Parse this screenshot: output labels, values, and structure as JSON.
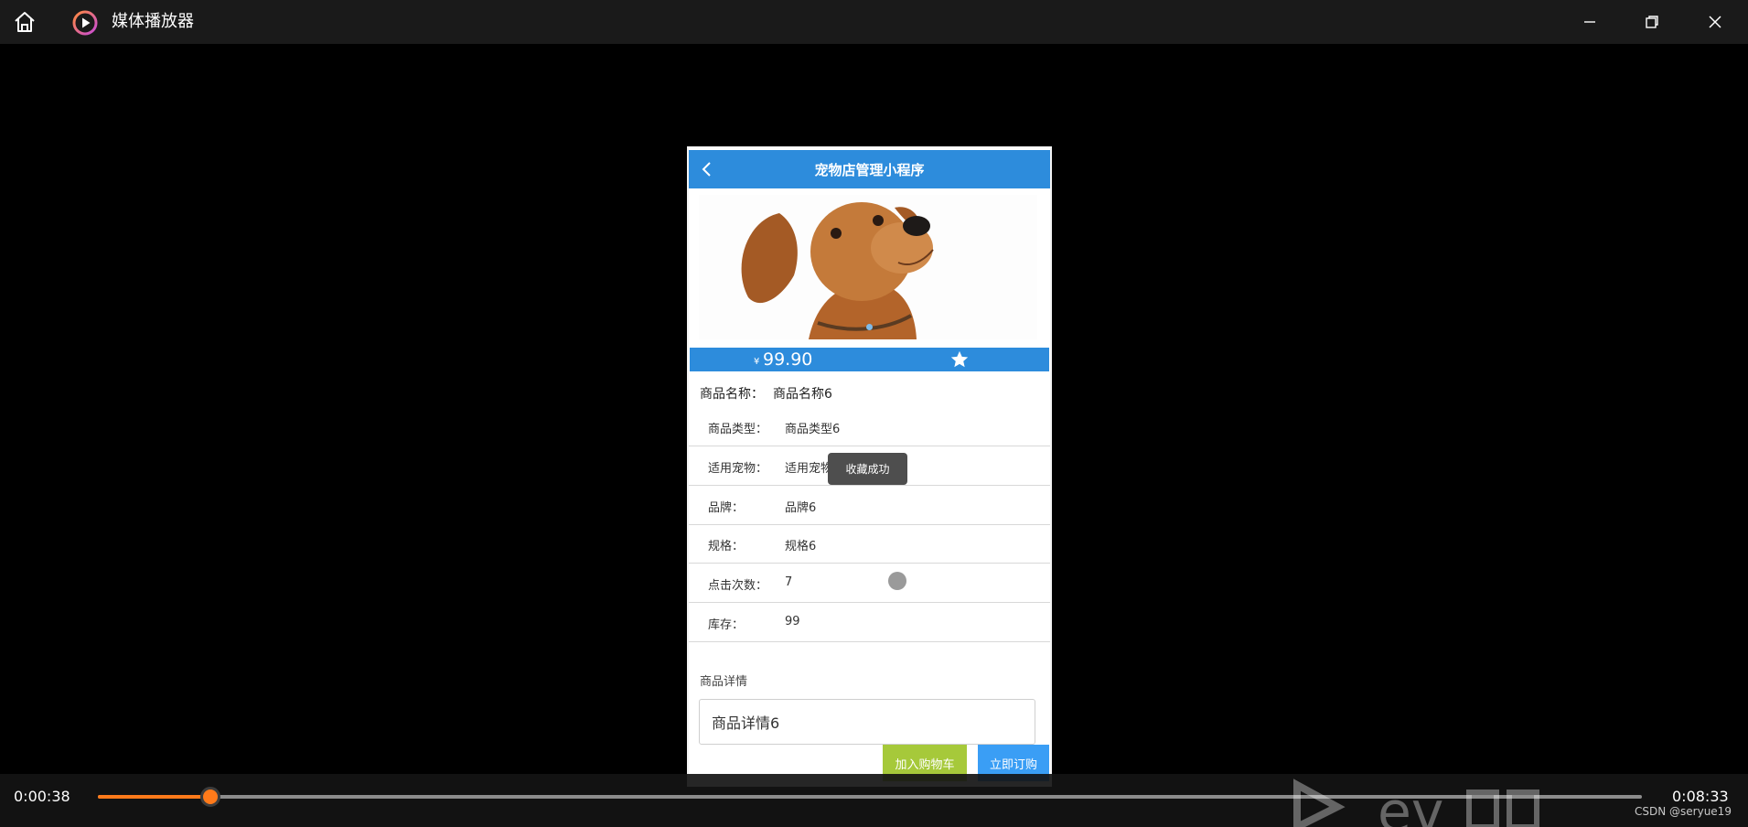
{
  "window": {
    "title": "媒体播放器",
    "icons": {
      "home": "home-icon",
      "logo": "play-logo-icon",
      "minimize": "minimize-icon",
      "maximize": "restore-icon",
      "close": "close-icon"
    }
  },
  "app": {
    "title": "宠物店管理小程序",
    "colors": {
      "primary": "#2d8cdc",
      "cart": "#a6c93a",
      "buy": "#3a9ef5"
    },
    "price_symbol": "¥",
    "price": "99.90",
    "product_name_label": "商品名称：",
    "product_name": "商品名称6",
    "attributes": [
      {
        "key": "商品类型：",
        "value": "商品类型6"
      },
      {
        "key": "适用宠物：",
        "value": "适用宠物6"
      },
      {
        "key": "品牌：",
        "value": "品牌6"
      },
      {
        "key": "规格：",
        "value": "规格6"
      },
      {
        "key": "点击次数：",
        "value": "7"
      },
      {
        "key": "库存：",
        "value": "99"
      }
    ],
    "detail_title": "商品详情",
    "detail_text": "商品详情6",
    "buttons": {
      "add_cart": "加入购物车",
      "buy_now": "立即订购"
    },
    "toast": "收藏成功"
  },
  "player": {
    "current_time": "0:00:38",
    "total_time": "0:08:33",
    "progress": 0.073,
    "accent": "#ff7a1a",
    "credit": "CSDN @seryue19"
  }
}
